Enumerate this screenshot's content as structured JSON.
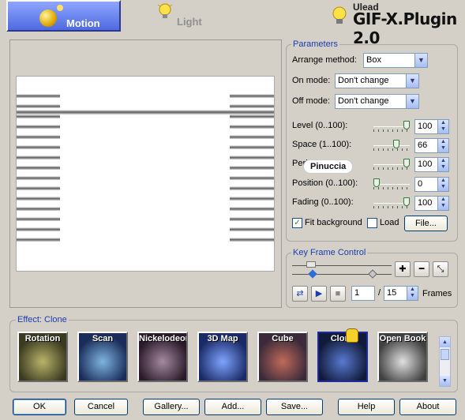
{
  "tabs": {
    "motion_label": "Motion",
    "light_label": "Light"
  },
  "brand": {
    "vendor": "Ulead",
    "product": "GIF-X.Plugin 2.0"
  },
  "parameters": {
    "legend": "Parameters",
    "arrange_method_label": "Arrange method:",
    "arrange_method_value": "Box",
    "on_mode_label": "On mode:",
    "on_mode_value": "Don't change",
    "off_mode_label": "Off mode:",
    "off_mode_value": "Don't change",
    "sliders": [
      {
        "label": "Level (0..100):",
        "value": "100",
        "fraction": 1.0
      },
      {
        "label": "Space (1..100):",
        "value": "66",
        "fraction": 0.66
      },
      {
        "label": "Peri",
        "value": "100",
        "fraction": 1.0
      },
      {
        "label": "Position (0..100):",
        "value": "0",
        "fraction": 0.0
      },
      {
        "label": "Fading (0..100):",
        "value": "100",
        "fraction": 1.0
      }
    ],
    "fit_background_label": "Fit background",
    "fit_background_checked": true,
    "load_label": "Load",
    "load_checked": false,
    "file_button": "File..."
  },
  "watermark": "Pinuccia",
  "keyframe": {
    "legend": "Key Frame Control",
    "current_frame": "1",
    "separator": "/",
    "total_frames": "15",
    "frames_label": "Frames"
  },
  "effects": {
    "legend": "Effect: Clone",
    "items": [
      {
        "label": "Rotation",
        "colors": [
          "#3a3a20",
          "#b9b46a"
        ]
      },
      {
        "label": "Scan",
        "colors": [
          "#1a2d5a",
          "#7fb4e0"
        ]
      },
      {
        "label": "Nickelodeon",
        "colors": [
          "#2a1a2a",
          "#a58aa0"
        ]
      },
      {
        "label": "3D Map",
        "colors": [
          "#1a2a66",
          "#7fa4ff"
        ]
      },
      {
        "label": "Cube",
        "colors": [
          "#3a2a3a",
          "#c06a5a"
        ]
      },
      {
        "label": "Clone",
        "colors": [
          "#101a3a",
          "#5a7ad0"
        ]
      },
      {
        "label": "Open Book",
        "colors": [
          "#404040",
          "#e0e0e0"
        ]
      }
    ],
    "selected_index": 5
  },
  "buttons": {
    "ok": "OK",
    "cancel": "Cancel",
    "gallery": "Gallery...",
    "add": "Add...",
    "save": "Save...",
    "help": "Help",
    "about": "About"
  }
}
